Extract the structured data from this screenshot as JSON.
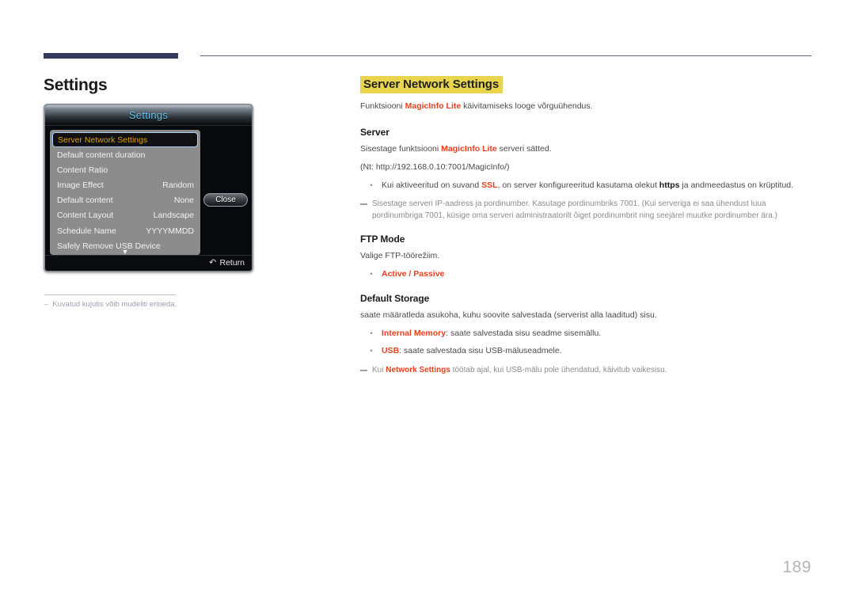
{
  "page": {
    "number": "189"
  },
  "left": {
    "title": "Settings",
    "osd": {
      "header_title": "Settings",
      "close_label": "Close",
      "return_label": "Return",
      "return_icon": "undo-arrow-icon",
      "scroll_down_icon": "▼",
      "items": [
        {
          "label": "Server Network Settings",
          "value": "",
          "selected": true
        },
        {
          "label": "Default content duration",
          "value": "",
          "selected": false
        },
        {
          "label": "Content Ratio",
          "value": "",
          "selected": false
        },
        {
          "label": "Image Effect",
          "value": "Random",
          "selected": false
        },
        {
          "label": "Default content",
          "value": "None",
          "selected": false
        },
        {
          "label": "Content Layout",
          "value": "Landscape",
          "selected": false
        },
        {
          "label": "Schedule Name",
          "value": "YYYYMMDD",
          "selected": false
        },
        {
          "label": "Safely Remove USB Device",
          "value": "",
          "selected": false
        }
      ]
    },
    "note": {
      "dash": "‒",
      "text": "Kuvatud kujutis võib mudeliti erineda."
    }
  },
  "right": {
    "section_title": "Server Network Settings",
    "intro": {
      "pre": "Funktsiooni ",
      "brand": "MagicInfo Lite",
      "post": " käivitamiseks looge võrguühendus."
    },
    "server": {
      "heading": "Server",
      "line1_pre": "Sisestage funktsiooni ",
      "line1_brand": "MagicInfo Lite",
      "line1_post": " serveri sätted.",
      "line2": "(Nt: http://192.168.0.10:7001/MagicInfo/)",
      "bullet_pre": "Kui aktiveeritud on suvand ",
      "bullet_ssl": "SSL",
      "bullet_mid": ", on server konfigureeritud kasutama olekut ",
      "bullet_https": "https",
      "bullet_post": " ja andmeedastus on krüptitud.",
      "note": "Sisestage serveri IP-aadress ja pordinumber. Kasutage pordinumbriks 7001. (Kui serveriga ei saa ühendust luua pordinumbriga 7001, küsige oma serveri administraatorilt õiget pordinumbrit ning seejärel muutke pordinumber ära.)"
    },
    "ftp": {
      "heading": "FTP Mode",
      "desc": "Valige FTP-töörežiim.",
      "bullet_active": "Active",
      "bullet_sep": " / ",
      "bullet_passive": "Passive"
    },
    "storage": {
      "heading": "Default Storage",
      "desc": "saate määratleda asukoha, kuhu soovite salvestada (serverist alla laaditud) sisu.",
      "bullet1_label": "Internal Memory",
      "bullet1_text": ": saate salvestada sisu seadme sisemällu.",
      "bullet2_label": "USB",
      "bullet2_text": ": saate salvestada sisu USB-mäluseadmele.",
      "note_pre": "Kui ",
      "note_brand": "Network Settings",
      "note_post": " töötab ajal, kui USB-mälu pole ühendatud, käivitub vaikesisu."
    }
  }
}
